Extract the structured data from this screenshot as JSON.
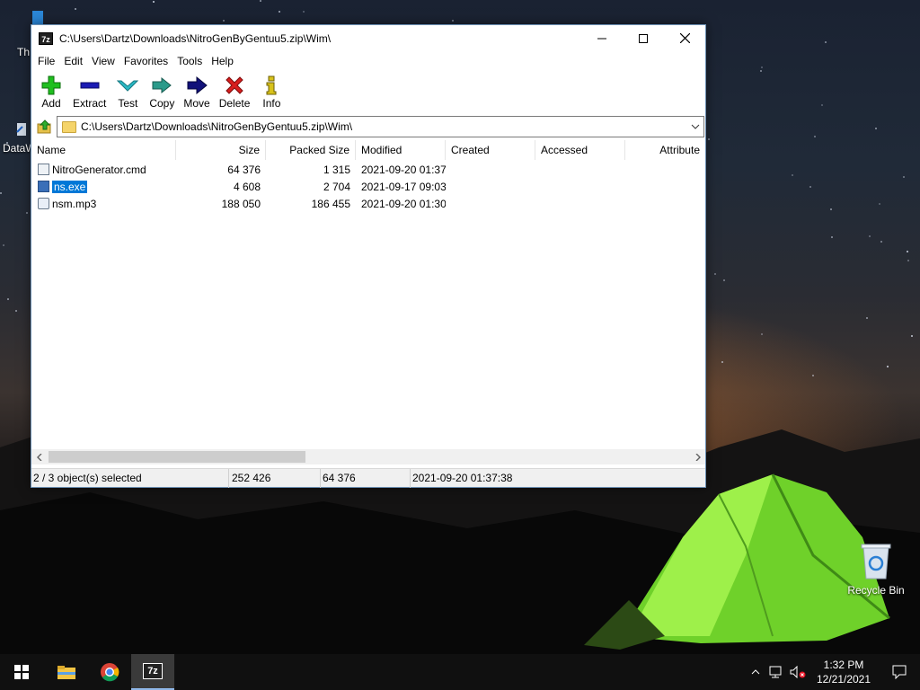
{
  "window": {
    "title": "C:\\Users\\Dartz\\Downloads\\NitroGenByGentuu5.zip\\Wim\\",
    "app_icon_text": "7z"
  },
  "menu": [
    "File",
    "Edit",
    "View",
    "Favorites",
    "Tools",
    "Help"
  ],
  "toolbar": [
    {
      "label": "Add",
      "icon": "plus-icon",
      "color": "#1fbf1f"
    },
    {
      "label": "Extract",
      "icon": "minus-icon",
      "color": "#1b1bb4"
    },
    {
      "label": "Test",
      "icon": "check-icon",
      "color": "#2ab8c4"
    },
    {
      "label": "Copy",
      "icon": "copy-arrow-icon",
      "color": "#2a9a8a"
    },
    {
      "label": "Move",
      "icon": "move-arrow-icon",
      "color": "#11117a"
    },
    {
      "label": "Delete",
      "icon": "delete-x-icon",
      "color": "#d81e1e"
    },
    {
      "label": "Info",
      "icon": "info-icon",
      "color": "#d8c21a"
    }
  ],
  "address": {
    "path": "C:\\Users\\Dartz\\Downloads\\NitroGenByGentuu5.zip\\Wim\\"
  },
  "columns": [
    "Name",
    "Size",
    "Packed Size",
    "Modified",
    "Created",
    "Accessed",
    "Attribute"
  ],
  "files": [
    {
      "name": "NitroGenerator.cmd",
      "size": "64 376",
      "packed": "1 315",
      "modified": "2021-09-20 01:37",
      "icon": "cmd-file-icon",
      "selected": false
    },
    {
      "name": "ns.exe",
      "size": "4 608",
      "packed": "2 704",
      "modified": "2021-09-17 09:03",
      "icon": "exe-file-icon",
      "selected": true
    },
    {
      "name": "nsm.mp3",
      "size": "188 050",
      "packed": "186 455",
      "modified": "2021-09-20 01:30",
      "icon": "mp3-file-icon",
      "selected": false
    }
  ],
  "status": {
    "selection": "2 / 3 object(s) selected",
    "total_size": "252 426",
    "selected_size": "64 376",
    "modified": "2021-09-20 01:37:38"
  },
  "desktop": {
    "icons": [
      {
        "label": "Th"
      },
      {
        "label": "DataW"
      },
      {
        "label": "Recycle Bin"
      }
    ]
  },
  "taskbar": {
    "time": "1:32 PM",
    "date": "12/21/2021"
  },
  "colors": {
    "selection": "#0078d7",
    "taskbar": "#101010"
  }
}
